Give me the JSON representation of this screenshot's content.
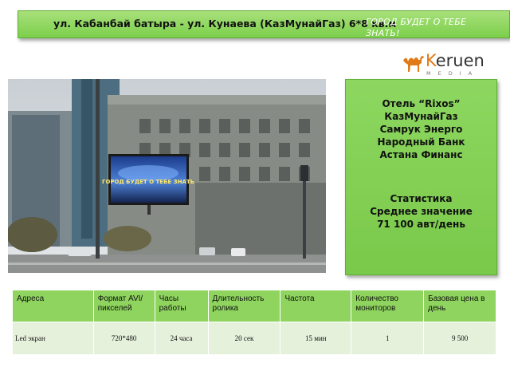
{
  "header": {
    "title": "ул. Кабанбай батыра - ул. Кунаева (КазМунайГаз) 6*8 кв.м",
    "slogan": "ГОРОД БУДЕТ О ТЕБЕ ЗНАТЬ!"
  },
  "logo": {
    "brand_k": "K",
    "brand_rest": "eruen",
    "tagline": "MEDIA"
  },
  "billboard": {
    "screen_text": "ГОРОД БУДЕТ О ТЕБЕ ЗНАТЬ"
  },
  "info": {
    "advertisers": [
      "Отель “Rixos”",
      "КазМунайГаз",
      "Самрук Энерго",
      "Народный Банк",
      "Астана Финанс"
    ],
    "stats": [
      "Статистика",
      "Среднее значение",
      "71 100 авт/день"
    ]
  },
  "table": {
    "headers": [
      "Адреса",
      "Формат AVI/ пикселей",
      "Часы работы",
      "Длительность ролика",
      "Частота",
      "Количество мониторов",
      "Базовая цена в день"
    ],
    "row": [
      "Led экран",
      "720*480",
      "24 часа",
      "20 сек",
      "15 мин",
      "1",
      "9 500"
    ]
  },
  "colors": {
    "accent_green": "#8ed45e",
    "logo_orange": "#e07a16",
    "table_row_bg": "#e6f1dc"
  }
}
